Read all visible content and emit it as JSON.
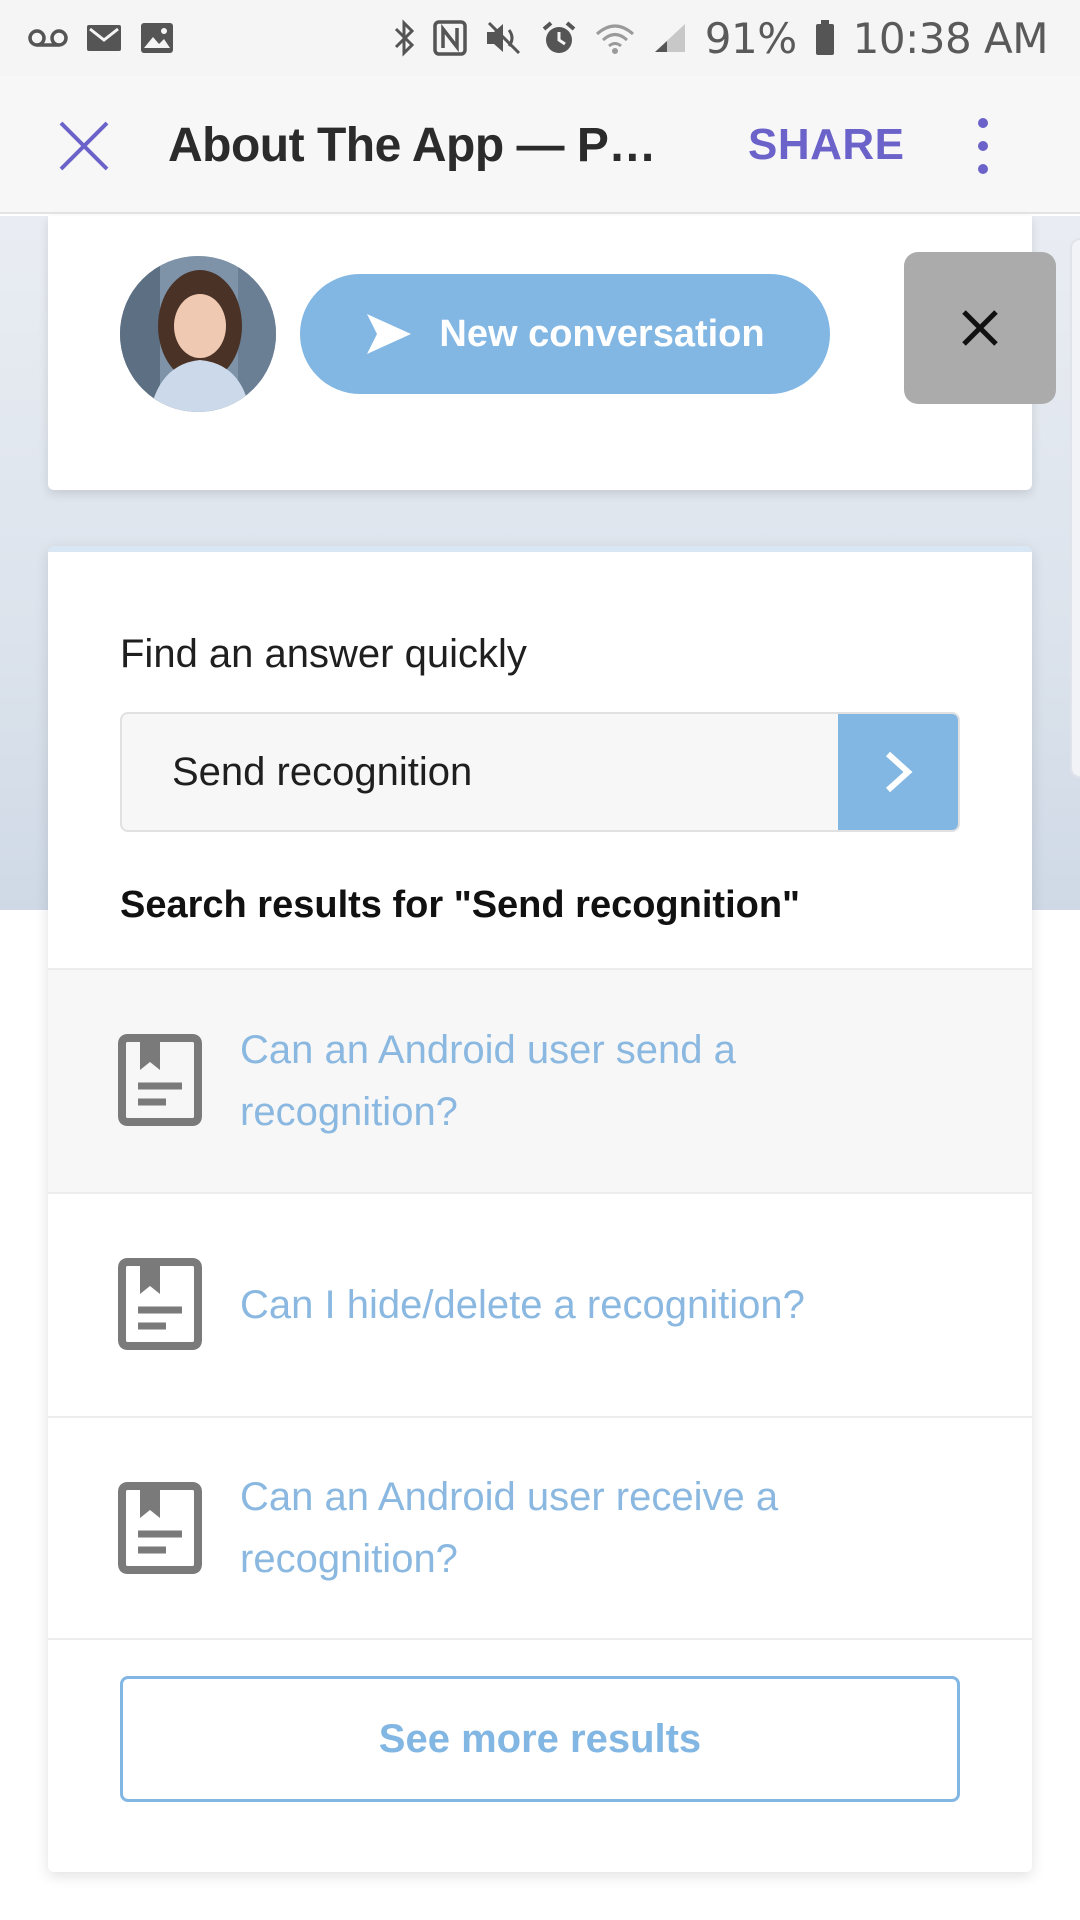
{
  "status_bar": {
    "battery": "91%",
    "time": "10:38 AM",
    "icons": [
      "voicemail-icon",
      "gmail-icon",
      "image-icon",
      "bluetooth-icon",
      "nfc-icon",
      "mute-icon",
      "alarm-icon",
      "wifi-icon",
      "signal-icon",
      "battery-icon"
    ]
  },
  "app_bar": {
    "title": "About The App — Preci…",
    "share_label": "SHARE"
  },
  "top_card": {
    "new_conversation_label": "New conversation"
  },
  "search": {
    "label": "Find an answer quickly",
    "value": "Send recognition",
    "results_heading": "Search results for \"Send recognition\"",
    "results": [
      {
        "text": "Can an Android user send a recognition?"
      },
      {
        "text": "Can I hide/delete a recognition?"
      },
      {
        "text": "Can an Android user receive a recognition?"
      }
    ],
    "see_more_label": "See more results"
  },
  "colors": {
    "accent": "#82b6e3",
    "appbar_accent": "#6b63c9",
    "link": "#8ab8e0"
  }
}
